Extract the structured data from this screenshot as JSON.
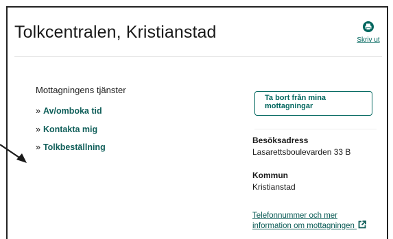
{
  "page": {
    "title": "Tolkcentralen, Kristianstad",
    "print_label": "Skriv ut"
  },
  "services": {
    "heading": "Mottagningens tjänster",
    "items": [
      {
        "label": "Av/omboka tid"
      },
      {
        "label": "Kontakta mig"
      },
      {
        "label": "Tolkbeställning"
      }
    ]
  },
  "sidebar": {
    "remove_button": "Ta bort från mina mottagningar",
    "visit_address_label": "Besöksadress",
    "visit_address": "Lasarettsboulevarden 33 B",
    "municipality_label": "Kommun",
    "municipality": "Kristianstad",
    "more_info_link": "Telefonnummer och mer information om mottagningen"
  },
  "colors": {
    "accent": "#00665e",
    "text": "#1a1a1a"
  },
  "icons": {
    "print": "printer-icon",
    "external": "external-link-icon",
    "annotation": "arrow-icon"
  }
}
